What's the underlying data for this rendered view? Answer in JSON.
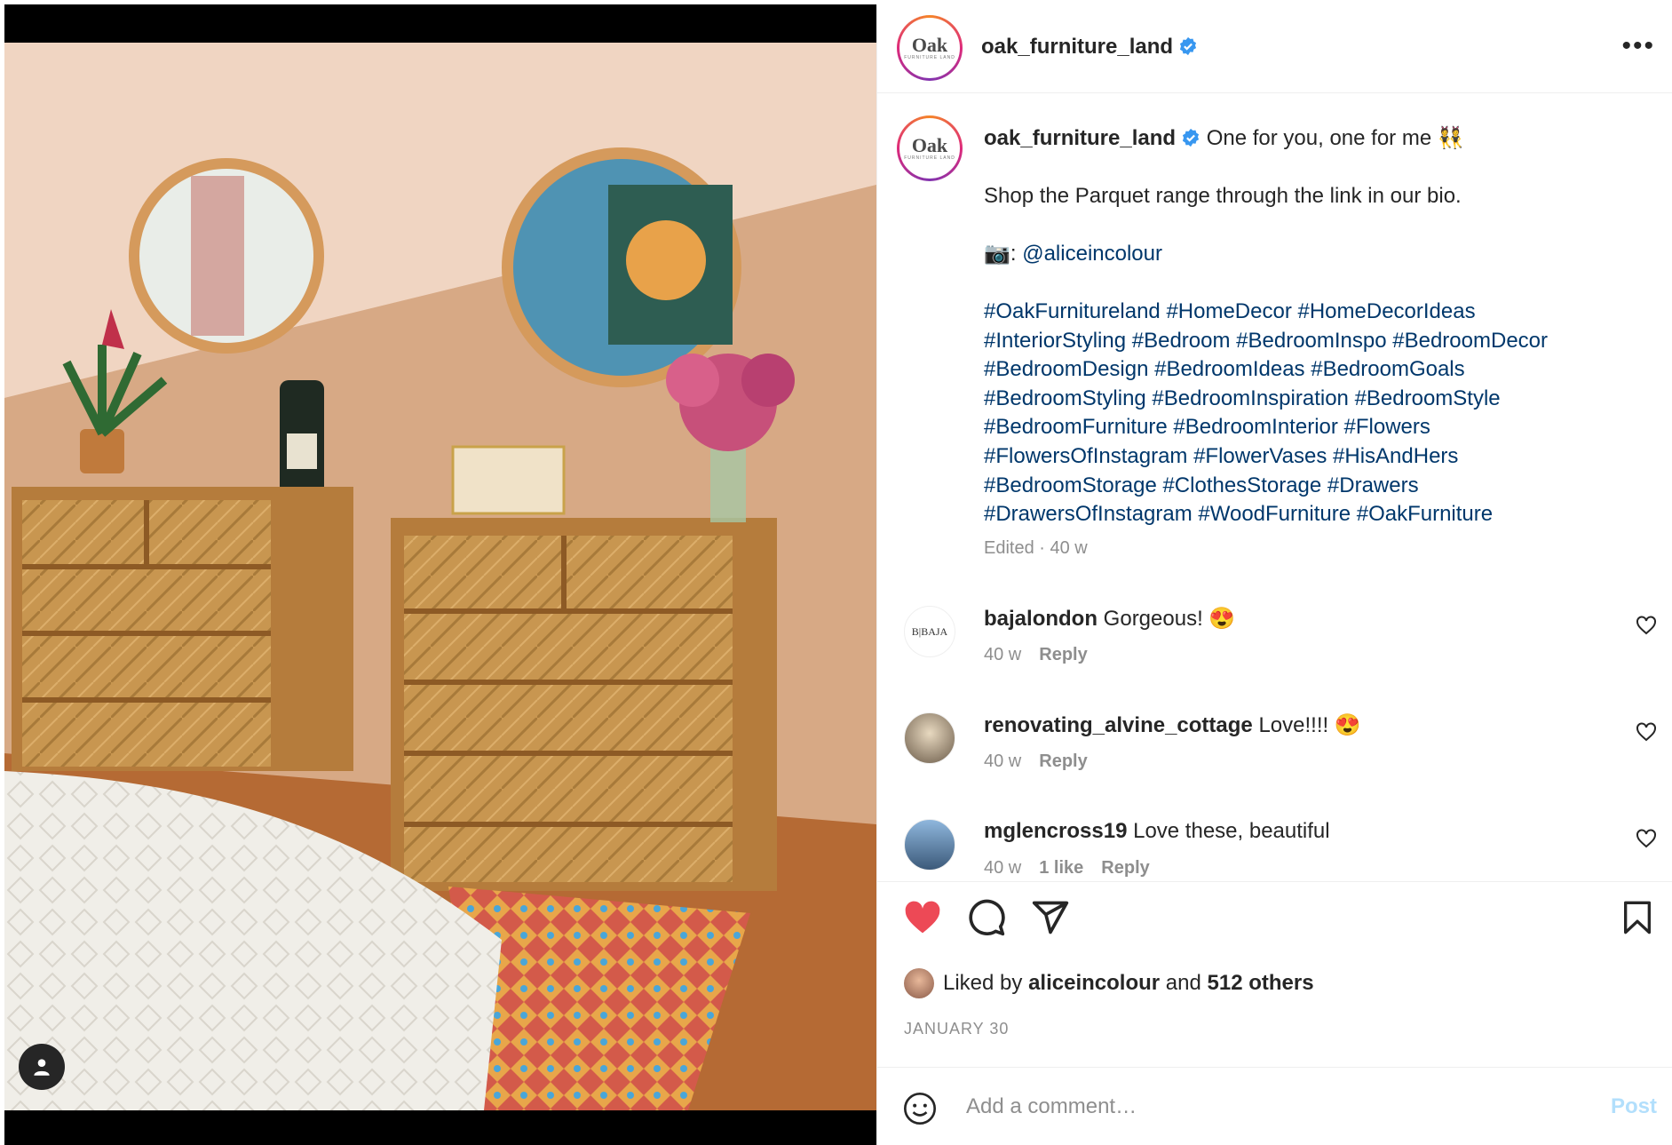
{
  "post": {
    "username": "oak_furniture_land",
    "logo_text": "Oak",
    "logo_subtext": "FURNITURE LAND",
    "caption_first": "One for you, one for me 👯",
    "caption_line2": "Shop the Parquet range through the link in our bio.",
    "credit_prefix": "📷: ",
    "credit_handle": "@aliceincolour",
    "hashtags": [
      "#OakFurnitureland #HomeDecor #HomeDecorIdeas",
      "#InteriorStyling #Bedroom #BedroomInspo #BedroomDecor",
      "#BedroomDesign #BedroomIdeas #BedroomGoals",
      "#BedroomStyling #BedroomInspiration #BedroomStyle",
      "#BedroomFurniture #BedroomInterior #Flowers",
      "#FlowersOfInstagram #FlowerVases #HisAndHers",
      "#BedroomStorage #ClothesStorage #Drawers",
      "#DrawersOfInstagram #WoodFurniture #OakFurniture"
    ],
    "edited_meta": "Edited · 40 w"
  },
  "comments": [
    {
      "user": "bajalondon",
      "text": "Gorgeous! 😍",
      "time": "40 w",
      "likes": "",
      "reply": "Reply",
      "avatar_text": "B|BAJA"
    },
    {
      "user": "renovating_alvine_cottage",
      "text": "Love!!!! 😍",
      "time": "40 w",
      "likes": "",
      "reply": "Reply"
    },
    {
      "user": "mglencross19",
      "text": "Love these, beautiful",
      "time": "40 w",
      "likes": "1 like",
      "reply": "Reply"
    }
  ],
  "likes": {
    "prefix": "Liked by ",
    "user": "aliceincolour",
    "middle": " and ",
    "count": "512 others"
  },
  "date": "JANUARY 30",
  "add_comment": {
    "placeholder": "Add a comment…",
    "post_label": "Post"
  },
  "colors": {
    "heart": "#ed4956",
    "link": "#00376b",
    "verified": "#3897f0",
    "post_disabled": "#b2dffc"
  }
}
